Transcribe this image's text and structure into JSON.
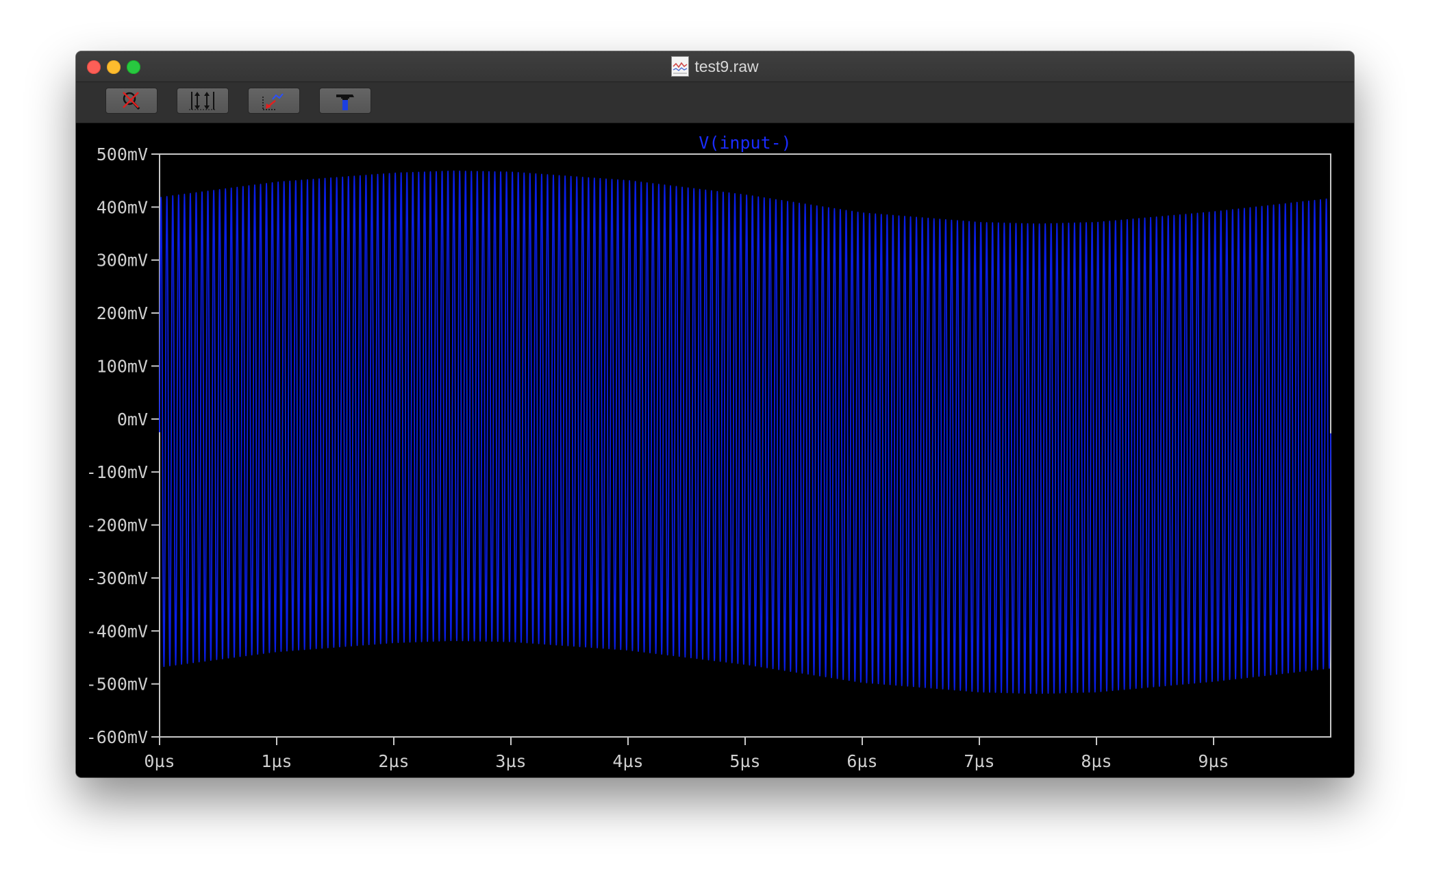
{
  "window": {
    "title": "test9.raw",
    "title_icon": "waveform-document-icon"
  },
  "toolbar": {
    "buttons": [
      {
        "name": "zoom-cancel-button",
        "icon": "magnifier-cancel-icon"
      },
      {
        "name": "autorange-y-button",
        "icon": "vertical-autorange-icon"
      },
      {
        "name": "zoom-back-button",
        "icon": "zoom-back-icon"
      },
      {
        "name": "settings-button",
        "icon": "hammer-icon"
      }
    ]
  },
  "colors": {
    "trace": "#0a1ee6",
    "trace_label": "#1a2cff",
    "axis": "#c8c8c8",
    "plot_background": "#000000"
  },
  "chart_data": {
    "type": "line",
    "trace_name": "V(input-)",
    "x_tick_labels": [
      "0µs",
      "1µs",
      "2µs",
      "3µs",
      "4µs",
      "5µs",
      "6µs",
      "7µs",
      "8µs",
      "9µs"
    ],
    "y_tick_labels": [
      "500mV",
      "400mV",
      "300mV",
      "200mV",
      "100mV",
      "0mV",
      "-100mV",
      "-200mV",
      "-300mV",
      "-400mV",
      "-500mV",
      "-600mV"
    ],
    "xlim": [
      0,
      10
    ],
    "ylim": [
      -600,
      500
    ],
    "x_unit": "µs",
    "y_unit": "mV",
    "series": [
      {
        "name": "V(input-)",
        "carrier_cycles": 200,
        "dc_offset_envelope": {
          "x": [
            0,
            1,
            2,
            2.5,
            3,
            4,
            5,
            6,
            7,
            7.5,
            8,
            9,
            10
          ],
          "y": [
            -25,
            4,
            21,
            25,
            23,
            7,
            -20,
            -54,
            -72,
            -75,
            -72,
            -52,
            -27
          ]
        },
        "amplitude": 443
      }
    ],
    "grid": false
  }
}
